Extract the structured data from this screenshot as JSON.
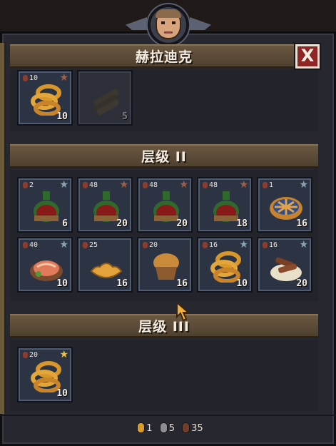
{
  "window": {
    "title": "赫拉迪克",
    "close_label": "X"
  },
  "sections": [
    {
      "label": "",
      "items": [
        {
          "icon": "onion-rings-icon",
          "badge": "10",
          "star": "bronze",
          "qty": "10",
          "dim": false
        },
        {
          "icon": "firewood-icon",
          "badge": "",
          "star": "",
          "qty": "5",
          "dim": true
        }
      ]
    },
    {
      "label": "层级 II",
      "items": [
        {
          "icon": "wine-bottle-icon",
          "badge": "2",
          "star": "silver",
          "qty": "6"
        },
        {
          "icon": "wine-bottle-icon",
          "badge": "48",
          "star": "bronze",
          "qty": "20"
        },
        {
          "icon": "wine-bottle-icon",
          "badge": "48",
          "star": "bronze",
          "qty": "20"
        },
        {
          "icon": "wine-bottle-icon",
          "badge": "48",
          "star": "bronze",
          "qty": "18"
        },
        {
          "icon": "berry-pie-icon",
          "badge": "1",
          "star": "silver",
          "qty": "16"
        },
        {
          "icon": "salmon-plate-icon",
          "badge": "40",
          "star": "silver",
          "qty": "10"
        },
        {
          "icon": "croissant-icon",
          "badge": "25",
          "star": "",
          "qty": "16"
        },
        {
          "icon": "muffin-icon",
          "badge": "20",
          "star": "",
          "qty": "16"
        },
        {
          "icon": "onion-rings-icon",
          "badge": "16",
          "star": "silver",
          "qty": "10"
        },
        {
          "icon": "jerky-plate-icon",
          "badge": "16",
          "star": "silver",
          "qty": "20"
        }
      ]
    },
    {
      "label": "层级 III",
      "items": [
        {
          "icon": "onion-rings-icon",
          "badge": "20",
          "star": "gold",
          "qty": "10"
        }
      ]
    }
  ],
  "footer": {
    "gold": "1",
    "silver": "5",
    "bronze": "35"
  },
  "colors": {
    "gold": "#d89b2a",
    "silver": "#8b8e92",
    "bronze": "#6c3e2b",
    "star_gold": "#f1c232",
    "star_silver": "#8aa3b6",
    "star_bronze": "#a06048"
  }
}
